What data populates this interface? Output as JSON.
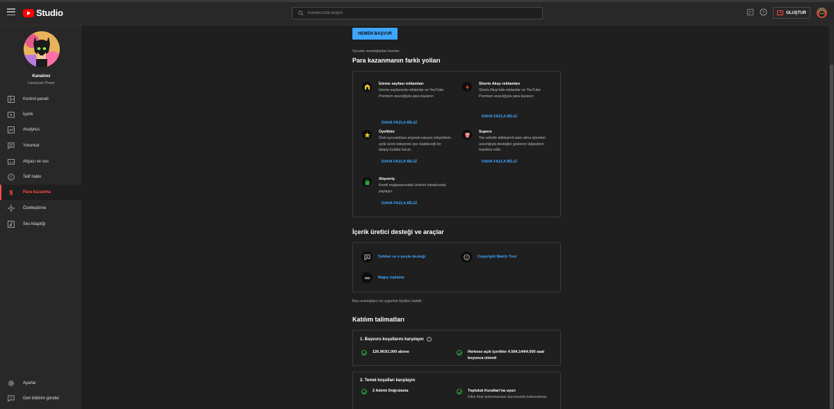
{
  "header": {
    "app_name": "Studio",
    "search_placeholder": "Kanalınızda arayın",
    "create_label": "OLUŞTUR"
  },
  "channel": {
    "name": "Kanalınız",
    "subtitle": "Cataclysm Power"
  },
  "sidebar": {
    "items": [
      {
        "label": "Kontrol paneli",
        "icon": "dashboard-icon"
      },
      {
        "label": "İçerik",
        "icon": "content-icon"
      },
      {
        "label": "Analytics",
        "icon": "analytics-icon"
      },
      {
        "label": "Yorumlar",
        "icon": "comments-icon"
      },
      {
        "label": "Altyazı ve ses",
        "icon": "subtitles-icon"
      },
      {
        "label": "Telif hakkı",
        "icon": "copyright-icon"
      },
      {
        "label": "Para kazanma",
        "icon": "monetization-icon"
      },
      {
        "label": "Özelleştirme",
        "icon": "customization-icon"
      },
      {
        "label": "Ses kitaplığı",
        "icon": "audio-library-icon"
      }
    ],
    "active_index": 6,
    "bottom": [
      {
        "label": "Ayarlar",
        "icon": "settings-icon"
      },
      {
        "label": "Geri bildirim gönder",
        "icon": "feedback-icon"
      }
    ]
  },
  "main": {
    "apply_button": "HEMEN BAŞVUR",
    "benefits_intro": "Sunulan avantajlardan bazıları:",
    "ways_title": "Para kazanmanın farklı yolları",
    "features": [
      {
        "title": "İzleme sayfası reklamları",
        "desc": "İzleme sayfasında reklamlar ve YouTube Premium aracılığıyla para kazanın",
        "link": "DAHA FAZLA BİLGİ",
        "icon": "watch-page-ads-icon",
        "color": "#f7c72b"
      },
      {
        "title": "Shorts Akışı reklamları",
        "desc": "Shorts Akışı'nda reklamlar ve YouTube Premium aracılığıyla para kazanın",
        "link": "DAHA FAZLA BİLGİ",
        "icon": "shorts-ads-icon",
        "color": "#ff4e1b"
      },
      {
        "title": "Üyelikler",
        "desc": "Özel ayrıcalıklara erişmek isteyen izleyicilerin aylık ücret ödeyerek üye olabileceği bir takipçi kulübü kurun.",
        "link": "DAHA FAZLA BİLGİ",
        "icon": "memberships-icon",
        "color": "#f7c72b"
      },
      {
        "title": "Supers",
        "desc": "Tek seferlik etkileşimli satın alma işlemleri aracılığıyla desteğini gösteren takipçilere teşekkür edin.",
        "link": "DAHA FAZLA BİLGİ",
        "icon": "supers-icon",
        "color": "#ff7f7f"
      },
      {
        "title": "Alışveriş",
        "desc": "Kendi mağazanızdaki ürünleri kanalınızda paylaşın.",
        "link": "DAHA FAZLA BİLGİ",
        "icon": "shopping-icon",
        "color": "#2ba640"
      }
    ],
    "tools_title": "İçerik üretici desteği ve araçlar",
    "tools": [
      {
        "label": "Sohbet ve e-posta desteği",
        "icon": "chat-support-icon"
      },
      {
        "label": "Copyright Match Tool",
        "icon": "copyright-match-icon"
      },
      {
        "label": "Bağış toplama",
        "icon": "fundraising-icon"
      }
    ],
    "eligibility_note": "Bazı avantajların ek uygunluk ölçütleri olabilir.",
    "join_title": "Katılım talimatları",
    "step1": {
      "title": "1. Başvuru koşullarını karşılayın",
      "items": [
        {
          "text": "126.963/1.000 abone"
        },
        {
          "text": "Herkese açık içerikler 4.564.144/4.000 saat boyunca izlendi"
        }
      ]
    },
    "step2": {
      "title": "2. Temel koşulları karşılayın",
      "items": [
        {
          "text": "2 Adımlı Doğrulama",
          "sub": ""
        },
        {
          "text": "Topluluk Kuralları'na uyun",
          "sub": "Etkin ihtar bulunmaması durumunda kullanılamaz"
        }
      ]
    }
  }
}
